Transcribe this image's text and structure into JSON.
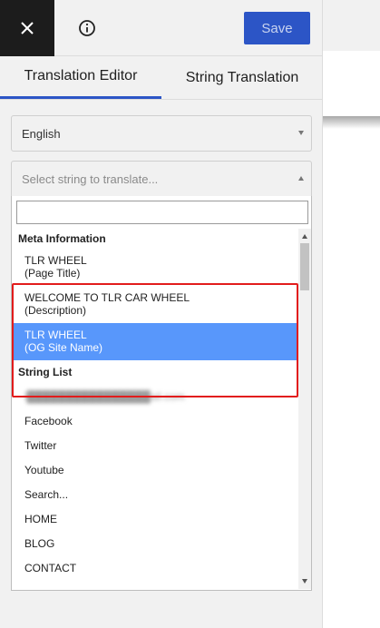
{
  "header": {
    "close_icon": "close-icon",
    "info_icon": "info-icon",
    "save_label": "Save"
  },
  "tabs": [
    {
      "label": "Translation Editor",
      "active": true
    },
    {
      "label": "String Translation",
      "active": false
    }
  ],
  "language_select": {
    "value": "English"
  },
  "string_select": {
    "placeholder": "Select string to translate..."
  },
  "dropdown": {
    "search_value": "",
    "groups": {
      "meta": {
        "label": "Meta Information",
        "items": [
          {
            "title": "TLR WHEEL",
            "subtitle": "(Page Title)"
          },
          {
            "title": "WELCOME TO TLR CAR WHEEL",
            "subtitle": "(Description)"
          },
          {
            "title": "TLR WHEEL",
            "subtitle": "(OG Site Name)",
            "highlighted": true
          }
        ]
      },
      "strings": {
        "label": "String List",
        "items": [
          {
            "label": "l████████████████ail.com",
            "redacted": true
          },
          {
            "label": "Facebook"
          },
          {
            "label": "Twitter"
          },
          {
            "label": "Youtube"
          },
          {
            "label": "Search..."
          },
          {
            "label": "HOME"
          },
          {
            "label": "BLOG"
          },
          {
            "label": "CONTACT"
          }
        ]
      }
    }
  },
  "colors": {
    "accent": "#2c55c6",
    "highlight": "#5897fb",
    "annotation_red": "#e21c1c"
  }
}
